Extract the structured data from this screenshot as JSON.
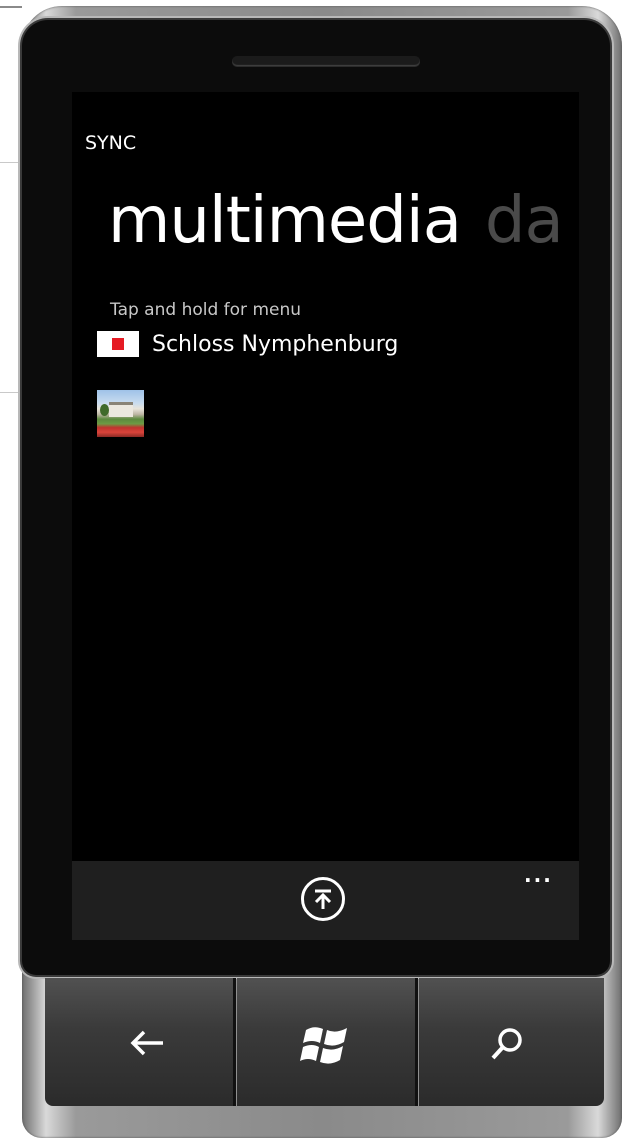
{
  "app": {
    "title": "SYNC"
  },
  "pivot": {
    "active": "multimedia",
    "next": "da"
  },
  "content": {
    "hint": "Tap and hold for menu",
    "items": [
      {
        "label": "Schloss Nymphenburg",
        "icon": "red-square-icon"
      }
    ],
    "thumbnail": "palace-photo-thumbnail"
  },
  "appbar": {
    "button_icon": "upload-icon",
    "more": "..."
  },
  "hardware": {
    "back_icon": "back-arrow-icon",
    "start_icon": "windows-logo-icon",
    "search_icon": "search-icon"
  },
  "colors": {
    "screen_bg": "#000000",
    "appbar_bg": "#1f1f1f",
    "accent_red": "#e51b24",
    "pivot_inactive": "#4a4a4a"
  }
}
